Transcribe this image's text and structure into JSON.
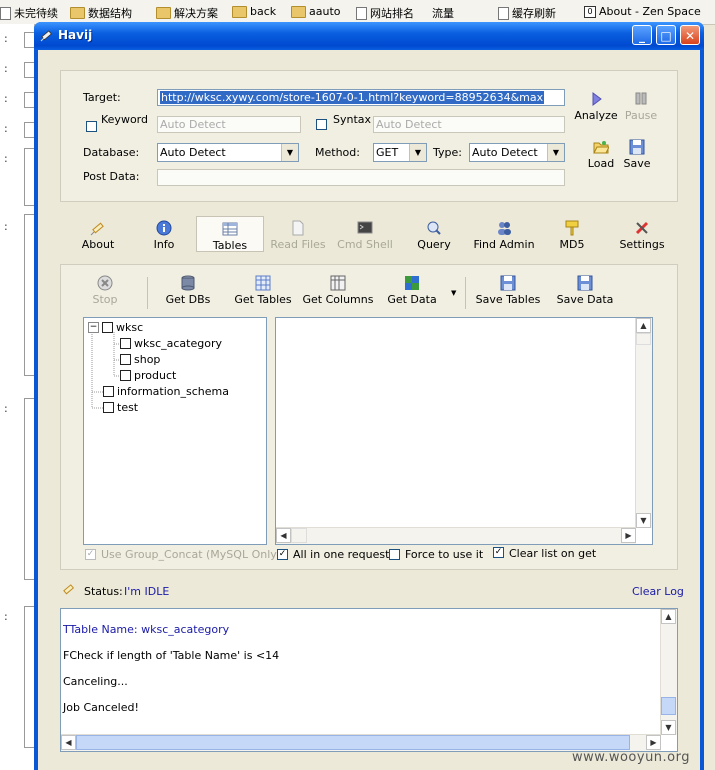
{
  "browser_bookmarks": [
    {
      "icon": "page",
      "label": "未完待续"
    },
    {
      "icon": "folder",
      "label": "数据结构"
    },
    {
      "icon": "folder",
      "label": "解决方案"
    },
    {
      "icon": "folder",
      "label": "back"
    },
    {
      "icon": "folder",
      "label": "aauto"
    },
    {
      "icon": "page",
      "label": "网站排名"
    },
    {
      "icon": "page",
      "label": "流量"
    },
    {
      "icon": "page",
      "label": "缓存刷新"
    },
    {
      "icon": "page",
      "label": "About - Zen Space"
    }
  ],
  "window": {
    "title": "Havij",
    "minimize": "_",
    "maximize": "□",
    "close": "✕"
  },
  "target_panel": {
    "target_label": "Target:",
    "target_value": "http://wksc.xywy.com/store-1607-0-1.html?keyword=88952634&max",
    "keyword_label": "Keyword",
    "keyword_placeholder": "Auto Detect",
    "syntax_label": "Syntax",
    "syntax_placeholder": "Auto Detect",
    "database_label": "Database:",
    "database_value": "Auto Detect",
    "method_label": "Method:",
    "method_value": "GET",
    "type_label": "Type:",
    "type_value": "Auto Detect",
    "post_label": "Post Data:",
    "analyze": "Analyze",
    "pause": "Pause",
    "load": "Load",
    "save": "Save"
  },
  "nav": {
    "about": "About",
    "info": "Info",
    "tables": "Tables",
    "read_files": "Read Files",
    "cmd_shell": "Cmd Shell",
    "query": "Query",
    "find_admin": "Find Admin",
    "md5": "MD5",
    "settings": "Settings"
  },
  "toolbar": {
    "stop": "Stop",
    "get_dbs": "Get DBs",
    "get_tables": "Get Tables",
    "get_columns": "Get Columns",
    "get_data": "Get Data",
    "save_tables": "Save Tables",
    "save_data": "Save Data"
  },
  "tree": [
    {
      "label": "wksc",
      "indent": 0,
      "expander": "−"
    },
    {
      "label": "wksc_acategory",
      "indent": 2
    },
    {
      "label": "shop",
      "indent": 2
    },
    {
      "label": "product",
      "indent": 2
    },
    {
      "label": "information_schema",
      "indent": 1
    },
    {
      "label": "test",
      "indent": 1
    }
  ],
  "options": {
    "group_concat": "Use Group_Concat (MySQL Only)",
    "all_in_one": "All in one request.",
    "force": "Force to use it",
    "clear_list": "Clear list on get"
  },
  "status": {
    "label": "Status:",
    "value": "I'm IDLE",
    "clear_log": "Clear Log"
  },
  "log": [
    {
      "text": "TTable Name: wksc_acategory",
      "color": "#1a1aa6"
    },
    {
      "text": "FCheck if length of 'Table Name' is <14",
      "color": "#000000"
    },
    {
      "text": "Canceling...",
      "color": "#000000"
    },
    {
      "text": "Job Canceled!",
      "color": "#000000"
    }
  ],
  "watermark": "www.wooyun.org",
  "left_strip_marks": [
    ":",
    ":",
    ":",
    ":",
    ":",
    ":",
    ":",
    ":",
    ":"
  ]
}
